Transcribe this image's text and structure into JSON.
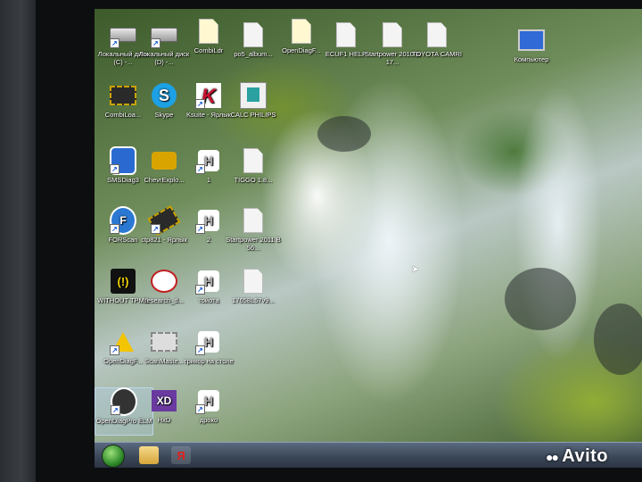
{
  "desktop": {
    "icons": [
      {
        "label": "Локальный диск (C) -...",
        "icon": "drive-icon"
      },
      {
        "label": "Локальный диск (D) -...",
        "icon": "drive-icon"
      },
      {
        "label": "CombiLdr",
        "icon": "document-help-icon"
      },
      {
        "label": "po5_album...",
        "icon": "document-icon"
      },
      {
        "label": "OpenDiagF...",
        "icon": "document-help-icon"
      },
      {
        "label": "ECUF1 HELP",
        "icon": "document-icon"
      },
      {
        "label": "Startpower 2010 B17...",
        "icon": "document-icon"
      },
      {
        "label": "TOYOTA CAMRI",
        "icon": "document-icon"
      },
      {
        "label": "Компьютер",
        "icon": "computer-icon"
      },
      {
        "label": "CombiLoa...",
        "icon": "chip-icon"
      },
      {
        "label": "Skype",
        "icon": "skype-icon"
      },
      {
        "label": "Ksuite - Ярлык",
        "icon": "ksuite-icon"
      },
      {
        "label": "CALC PHILIPS",
        "icon": "calc-icon"
      },
      {
        "label": "SMSDiag3",
        "icon": "car-diag-icon"
      },
      {
        "label": "ChevrExplo...",
        "icon": "engine-icon"
      },
      {
        "label": "1",
        "icon": "honda-icon"
      },
      {
        "label": "TIGGO 1.8...",
        "icon": "document-icon"
      },
      {
        "label": "FORScan",
        "icon": "forscan-icon"
      },
      {
        "label": "ctp821 - Ярлык",
        "icon": "chip-icon"
      },
      {
        "label": "2",
        "icon": "honda-icon"
      },
      {
        "label": "Startpower 2011 B56...",
        "icon": "document-icon"
      },
      {
        "label": "WITHOUT TPMS",
        "icon": "tpms-icon"
      },
      {
        "label": "research_d...",
        "icon": "toyota-icon"
      },
      {
        "label": "тойота",
        "icon": "honda-icon"
      },
      {
        "label": "17658L57v9...",
        "icon": "document-icon"
      },
      {
        "label": "OpenDiagF...",
        "icon": "warning-icon"
      },
      {
        "label": "ScanMaste...",
        "icon": "chip-icon"
      },
      {
        "label": "трикор на столе",
        "icon": "honda-icon"
      },
      {
        "label": "OpenDiagPro ELM",
        "icon": "car-diag-icon"
      },
      {
        "label": "HxD",
        "icon": "hxd-icon"
      },
      {
        "label": "дроко",
        "icon": "honda-icon"
      }
    ]
  },
  "taskbar": {
    "buttons": [
      {
        "icon": "start-orb-icon"
      },
      {
        "icon": "folder-icon",
        "label": ""
      },
      {
        "icon": "yandex-icon",
        "label": "Я"
      }
    ]
  },
  "watermark": {
    "text": "Avito"
  },
  "colors": {
    "accent": "#2f8a2a",
    "taskbar": "#3a4656",
    "watermark": "#ffffff"
  }
}
